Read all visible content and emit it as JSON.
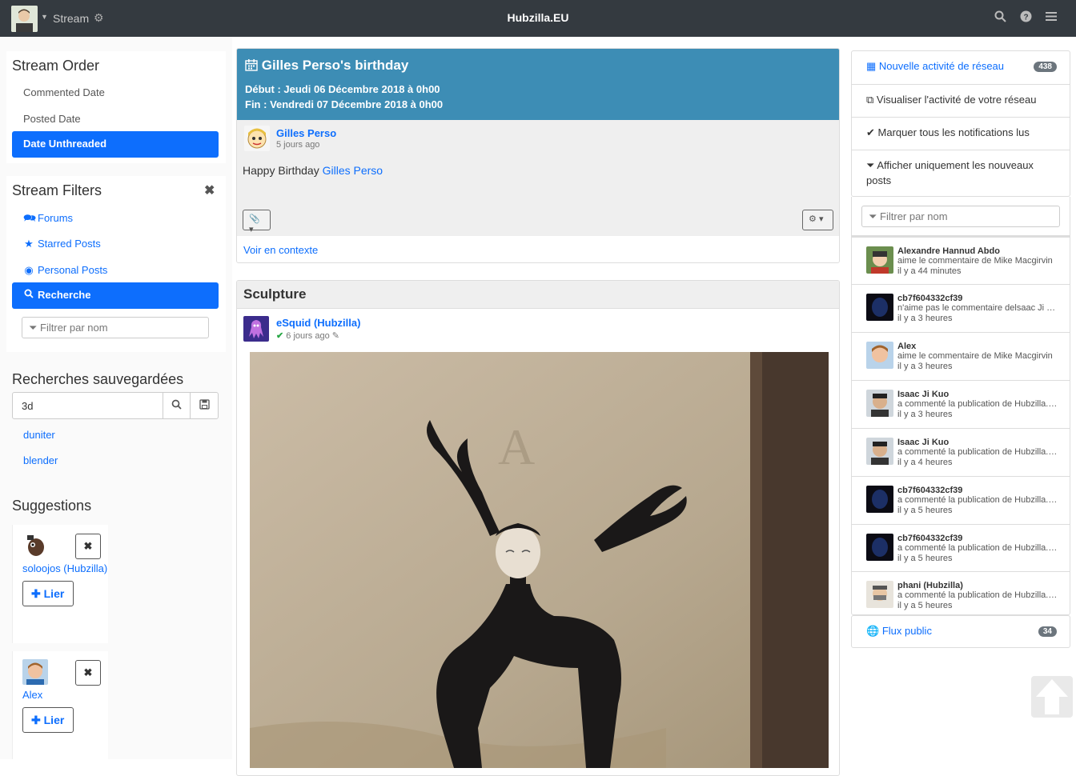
{
  "topbar": {
    "stream_label": "Stream",
    "brand": "Hubzilla.EU"
  },
  "stream_order": {
    "title": "Stream Order",
    "items": [
      {
        "label": "Commented Date"
      },
      {
        "label": "Posted Date"
      },
      {
        "label": "Date Unthreaded"
      }
    ]
  },
  "stream_filters": {
    "title": "Stream Filters",
    "items": [
      {
        "label": "Forums"
      },
      {
        "label": "Starred Posts"
      },
      {
        "label": "Personal Posts"
      },
      {
        "label": "Recherche"
      }
    ],
    "filter_placeholder": "Filtrer par nom"
  },
  "saved_searches": {
    "title": "Recherches sauvegardées",
    "query": "3d",
    "items": [
      {
        "label": "duniter"
      },
      {
        "label": "blender"
      }
    ]
  },
  "suggestions": {
    "title": "Suggestions",
    "items": [
      {
        "name": "soloojos (Hubzilla)",
        "connect_label": "Lier"
      },
      {
        "name": "Alex",
        "connect_label": "Lier"
      }
    ]
  },
  "post_birthday": {
    "title": "Gilles Perso's birthday",
    "start_label": "Début :",
    "start_value": "Jeudi 06 Décembre 2018 à 0h00",
    "end_label": "Fin :",
    "end_value": "Vendredi 07 Décembre 2018 à 0h00",
    "author": "Gilles Perso",
    "ago": "5 jours ago",
    "body_prefix": "Happy Birthday ",
    "body_link": "Gilles Perso",
    "context_link": "Voir en contexte"
  },
  "post_sculpture": {
    "title": "Sculpture",
    "author": "eSquid (Hubzilla)",
    "ago": "6 jours ago",
    "photo_text": "A"
  },
  "right_panel": {
    "new_activity": {
      "label": "Nouvelle activité de réseau",
      "count": "438"
    },
    "view_activity": "Visualiser l'activité de votre réseau",
    "mark_read": "Marquer tous les notifications lus",
    "only_new": "Afficher uniquement les nouveaux posts",
    "filter_placeholder": "Filtrer par nom",
    "notifications": [
      {
        "name": "Alexandre Hannud Abdo",
        "message": "aime le commentaire de Mike Macgirvin",
        "time": "il y a 44 minutes"
      },
      {
        "name": "cb7f604332cf39",
        "message": "n'aime pas le commentaire delsaac Ji Kuo",
        "time": "il y a 3 heures"
      },
      {
        "name": "Alex",
        "message": "aime le commentaire de Mike Macgirvin",
        "time": "il y a 3 heures"
      },
      {
        "name": "Isaac Ji Kuo",
        "message": "a commenté la publication de Hubzilla.EU",
        "time": "il y a 3 heures"
      },
      {
        "name": "Isaac Ji Kuo",
        "message": "a commenté la publication de Hubzilla.EU",
        "time": "il y a 4 heures"
      },
      {
        "name": "cb7f604332cf39",
        "message": "a commenté la publication de Hubzilla.EU",
        "time": "il y a 5 heures"
      },
      {
        "name": "cb7f604332cf39",
        "message": "a commenté la publication de Hubzilla.EU",
        "time": "il y a 5 heures"
      },
      {
        "name": "phani (Hubzilla)",
        "message": "a commenté la publication de Hubzilla.EU",
        "time": "il y a 5 heures"
      }
    ],
    "public_stream": {
      "label": "Flux public",
      "count": "34"
    }
  },
  "colors": {
    "accent": "#0d6efd",
    "topbar": "#343a40",
    "event_header": "#3d8db5"
  }
}
